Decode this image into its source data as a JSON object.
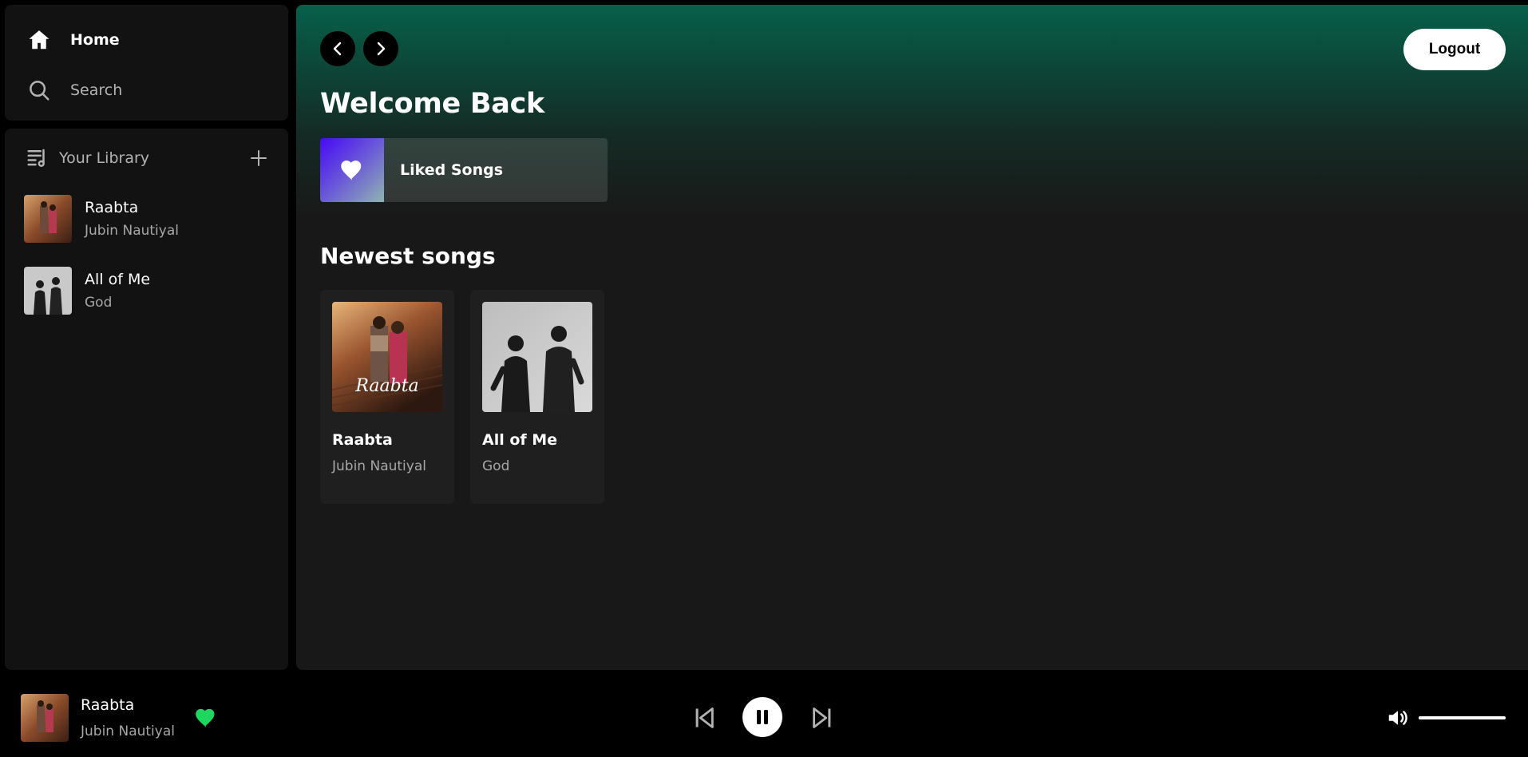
{
  "sidebar": {
    "nav": [
      {
        "label": "Home",
        "icon": "home-icon",
        "active": true
      },
      {
        "label": "Search",
        "icon": "search-icon",
        "active": false
      }
    ],
    "library": {
      "title": "Your Library",
      "items": [
        {
          "title": "Raabta",
          "subtitle": "Jubin Nautiyal"
        },
        {
          "title": "All of Me",
          "subtitle": "God"
        }
      ]
    }
  },
  "header": {
    "logout_label": "Logout"
  },
  "main": {
    "welcome": "Welcome Back",
    "liked_songs_label": "Liked Songs",
    "newest_title": "Newest songs",
    "cards": [
      {
        "title": "Raabta",
        "subtitle": "Jubin Nautiyal",
        "art_text": "Raabta"
      },
      {
        "title": "All of Me",
        "subtitle": "God"
      }
    ]
  },
  "player": {
    "title": "Raabta",
    "artist": "Jubin Nautiyal",
    "liked": true,
    "state": "playing",
    "volume": 1.0
  },
  "colors": {
    "accent_green": "#1ed760",
    "header_gradient_top": "#07604a",
    "panel": "#121212",
    "main_bg": "#181818"
  }
}
